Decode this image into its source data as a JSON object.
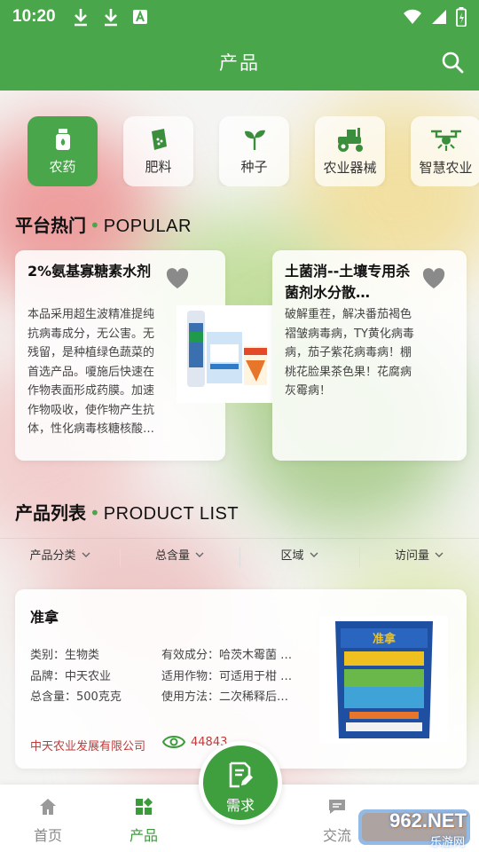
{
  "status_bar": {
    "time": "10:20",
    "icons": [
      "download-icon",
      "download-icon",
      "font-icon"
    ],
    "right_icons": [
      "wifi-icon",
      "signal-icon",
      "battery-icon"
    ]
  },
  "app_bar": {
    "title": "产品"
  },
  "categories": [
    {
      "label": "农药",
      "icon": "pesticide-bottle-icon",
      "active": true
    },
    {
      "label": "肥料",
      "icon": "fertilizer-bag-icon",
      "active": false
    },
    {
      "label": "种子",
      "icon": "sprout-icon",
      "active": false
    },
    {
      "label": "农业器械",
      "icon": "tractor-icon",
      "active": false
    },
    {
      "label": "智慧农业",
      "icon": "drone-icon",
      "active": false
    }
  ],
  "popular": {
    "title_cn": "平台热门",
    "title_en": "POPULAR",
    "items": [
      {
        "title": "2%氨基寡糖素水剂",
        "desc": "本品采用超生波精准提纯抗病毒成分，无公害。无残留，是种植绿色蔬菜的首选产品。嗄施后快速在作物表面形成药膜。加速作物吸收，使作物产生抗体，性化病毒核糖核酸…"
      },
      {
        "title": "土菌消--土壤专用杀菌剂水分散…",
        "desc": "破解重茬，解决番茄褐色褶皱病毒病，TY黄化病毒病，茄子紫花病毒病！棚桃花脸果茶色果！花腐病灰霉病！"
      }
    ]
  },
  "product_list": {
    "title_cn": "产品列表",
    "title_en": "PRODUCT LIST",
    "filters": [
      "产品分类",
      "总含量",
      "区域",
      "访问量"
    ],
    "items": [
      {
        "name": "准拿",
        "category_label": "类别：",
        "category": "生物类",
        "brand_label": "品牌：",
        "brand": "中天农业",
        "amount_label": "总含量：",
        "amount": "500克克",
        "ingredient_label": "有效成分：",
        "ingredient": "哈茨木霉菌 …",
        "crops_label": "适用作物：",
        "crops": "可适用于柑 …",
        "usage_label": "使用方法：",
        "usage": "二次稀释后…",
        "company": "中天农业发展有限公司",
        "views": "44843",
        "package_brand": "准拿",
        "package_colors": [
          "#1e4fa0",
          "#3fa3d8",
          "#f0c020"
        ]
      }
    ]
  },
  "bottom_nav": {
    "items": [
      {
        "label": "首页",
        "icon": "home-icon",
        "active": false
      },
      {
        "label": "产品",
        "icon": "grid-icon",
        "active": true
      },
      {
        "label": "交流",
        "icon": "chat-icon",
        "active": false
      }
    ],
    "fab_label": "需求"
  },
  "watermark": {
    "text": "962.NET",
    "sub": "乐游网"
  },
  "colors": {
    "primary": "#4aa64a",
    "accent_red": "#c23a3a"
  }
}
